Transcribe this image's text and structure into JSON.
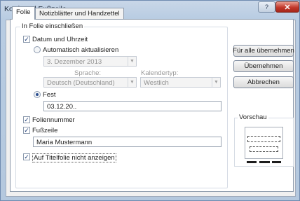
{
  "window": {
    "title": "Kopf- und Fußzeile",
    "help_label": "?",
    "close_label": "✕"
  },
  "tabs": [
    {
      "label": "Folie",
      "active": true
    },
    {
      "label": "Notizblätter und Handzettel",
      "active": false
    }
  ],
  "include_group": {
    "label": "In Folie einschließen",
    "date_time": {
      "label": "Datum und Uhrzeit",
      "checked": true
    },
    "auto_update": {
      "label": "Automatisch aktualisieren",
      "selected": false
    },
    "date_format_value": "3. Dezember 2013",
    "language": {
      "label": "Sprache:",
      "value": "Deutsch (Deutschland)"
    },
    "calendar": {
      "label": "Kalendertyp:",
      "value": "Westlich"
    },
    "fixed": {
      "label": "Fest",
      "selected": true,
      "value": "03.12.20.."
    },
    "slide_number": {
      "label": "Foliennummer",
      "checked": true
    },
    "footer": {
      "label": "Fußzeile",
      "checked": true,
      "value": "Maria Mustermann"
    },
    "hide_on_title": {
      "label": "Auf Titelfolie nicht anzeigen",
      "checked": true
    }
  },
  "buttons": {
    "apply_all": "Für alle übernehmen",
    "apply": "Übernehmen",
    "cancel": "Abbrechen"
  },
  "preview": {
    "label": "Vorschau"
  },
  "icons": {
    "checkmark": "✓",
    "dropdown": "▼"
  }
}
